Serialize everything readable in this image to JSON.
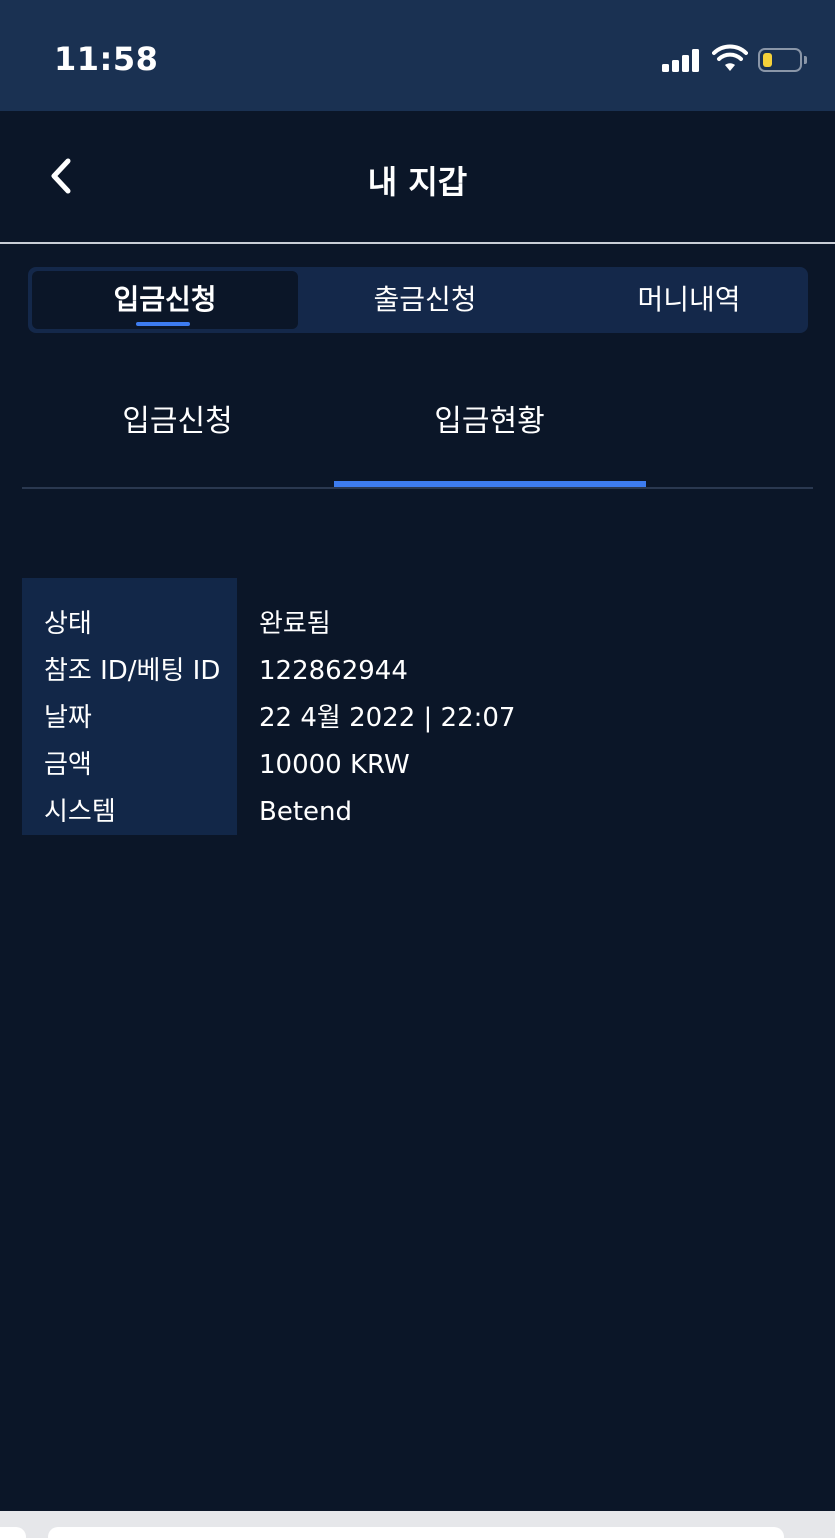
{
  "status_bar": {
    "time": "11:58",
    "icons": [
      "cellular-signal-icon",
      "wifi-icon",
      "battery-icon"
    ],
    "battery_color": "#f5d13a"
  },
  "header": {
    "title": "내 지갑",
    "back_icon": "chevron-left-icon"
  },
  "main_tabs": [
    {
      "label": "입금신청",
      "active": true
    },
    {
      "label": "출금신청",
      "active": false
    },
    {
      "label": "머니내역",
      "active": false
    }
  ],
  "sub_tabs": [
    {
      "label": "입금신청",
      "active": false
    },
    {
      "label": "입금현황",
      "active": true
    }
  ],
  "details": [
    {
      "label": "상태",
      "value": "완료됨"
    },
    {
      "label": "참조 ID/베팅 ID",
      "value": "122862944"
    },
    {
      "label": "날짜",
      "value": "22 4월 2022 | 22:07"
    },
    {
      "label": "금액",
      "value": "10000 KRW"
    },
    {
      "label": "시스템",
      "value": "Betend"
    }
  ],
  "colors": {
    "background": "#0b1628",
    "status_bar": "#1a3152",
    "accent": "#3d7cf0",
    "tab_bar": "#14284a",
    "label_column": "#122748"
  }
}
